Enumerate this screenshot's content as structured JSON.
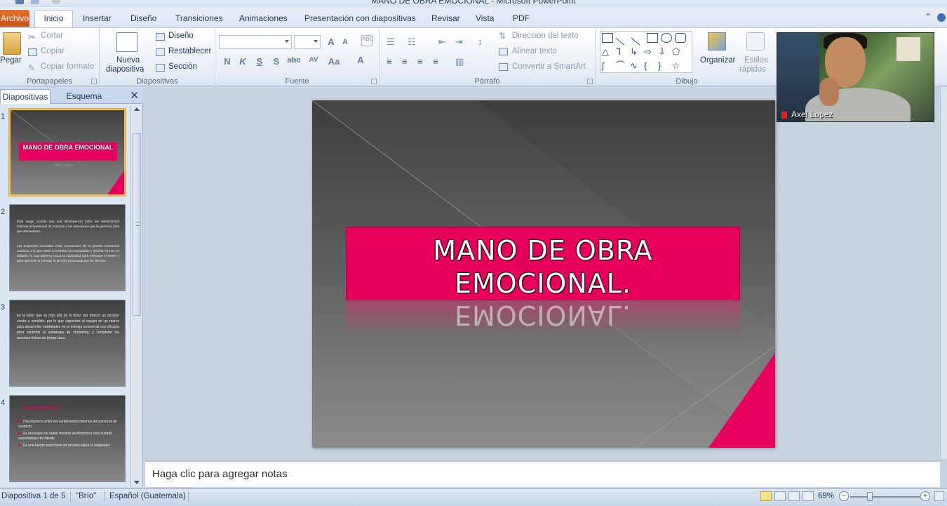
{
  "window": {
    "title": "MANO DE OBRA EMOCIONAL  -  Microsoft PowerPoint"
  },
  "tabs": [
    "Archivo",
    "Inicio",
    "Insertar",
    "Diseño",
    "Transiciones",
    "Animaciones",
    "Presentación con diapositivas",
    "Revisar",
    "Vista",
    "PDF"
  ],
  "ribbon": {
    "portapapeles": {
      "paste": "Pegar",
      "cut": "Cortar",
      "copy": "Copiar",
      "format_painter": "Copiar formato",
      "label": "Portapapeles"
    },
    "diapositivas": {
      "new_slide_1": "Nueva",
      "new_slide_2": "diapositiva",
      "layout": "Diseño",
      "reset": "Restablecer",
      "section": "Sección",
      "label": "Diapositivas"
    },
    "fuente": {
      "label": "Fuente",
      "bold": "N",
      "italic": "K",
      "underline": "S",
      "shadow": "S",
      "strike": "abc",
      "spacing": "AV",
      "case": "Aa",
      "color": "A",
      "grow": "A",
      "shrink": "A"
    },
    "parrafo": {
      "label": "Párrafo",
      "text_direction": "Dirección del texto",
      "align_text": "Alinear texto",
      "smartart": "Convertir a SmartArt"
    },
    "dibujo": {
      "label": "Dibujo",
      "arrange": "Organizar",
      "styles_1": "Estilos",
      "styles_2": "rápidos"
    }
  },
  "left_pane": {
    "tab_slides": "Diapositivas",
    "tab_outline": "Esquema",
    "close": "✕",
    "thumbs": [
      {
        "num": "1",
        "title": "MANO DE OBRA EMOCIONAL",
        "subtitle": "Axel Lopez"
      },
      {
        "num": "2",
        "p1": "Esta surge cuando hay una discrepancia entre los sentimientos internos del personal de contacto y las emociones que la gerencia pide que demuestren.",
        "p2": "Las empresas necesitan estar conscientes de la presión emocional continua a la que están sometidos sus empleados y diseñar formas de aliviarla, lo cual debería incluir la capacidad para enfrentar el estrés y para aprender a manejar la presión provocada por los clientes."
      },
      {
        "num": "3",
        "p1": "Es la labor que va más allá de lo físico por ofrecer un servicio cortés y sensible, por lo que capacitan al equipo de un marco para desarrollar habilidades en el manejo emocional con eficacia para controlar la estrategia de marketing, y completar los recursos físicos de forma clara."
      },
      {
        "num": "4",
        "heading": "Características",
        "b1": "Discrepancia entre los sentimientos internos del personal de contacto",
        "b2": "Es necesario no deber mostrar sentimientos para cumplir expectativas del cliente",
        "b3": "Es una fuente importante de presión sobre el empleado"
      }
    ]
  },
  "slide": {
    "title_line1": "MANO DE OBRA",
    "title_line2": "EMOCIONAL.",
    "reflection": "EMOCIONAL."
  },
  "notes": {
    "placeholder": "Haga clic para agregar notas"
  },
  "status": {
    "slide_count": "Diapositiva 1 de 5",
    "theme": "\"Brío\"",
    "language": "Español (Guatemala)",
    "zoom": "69%",
    "zoom_fraction": 0.28
  },
  "webcam": {
    "name": "Axel Lopez"
  },
  "colors": {
    "accent": "#e6005c",
    "file_tab": "#d55e22"
  }
}
